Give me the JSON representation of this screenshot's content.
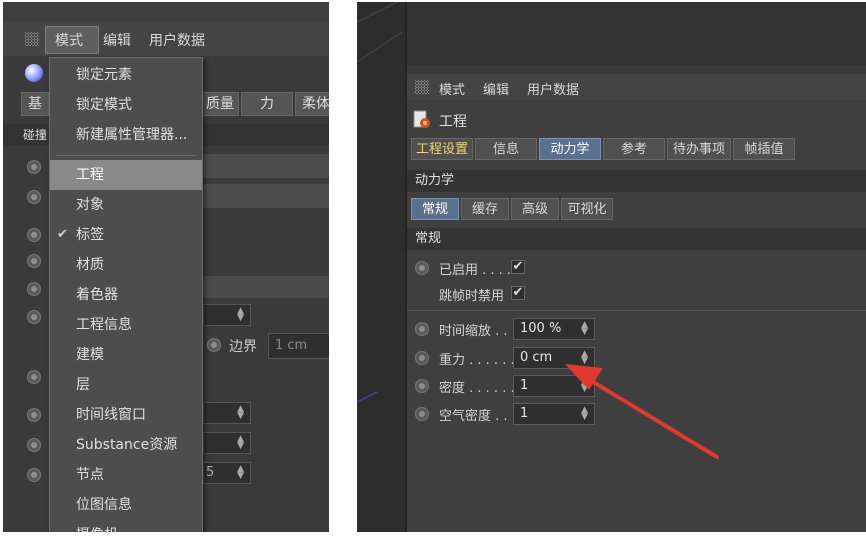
{
  "left": {
    "menubar": {
      "mode": "模式",
      "edit": "编辑",
      "userdata": "用户数据"
    },
    "tabs": [
      "基",
      "质量",
      "力",
      "柔体"
    ],
    "section": "碰撞",
    "border_label": "边界",
    "border_value": "1 cm",
    "partial_value": "5",
    "dropdown": {
      "items_top": [
        "锁定元素",
        "锁定模式",
        "新建属性管理器..."
      ],
      "items": [
        "工程",
        "对象",
        "标签",
        "材质",
        "着色器",
        "工程信息",
        "建模",
        "层",
        "时间线窗口",
        "Substance资源",
        "节点",
        "位图信息",
        "摄像机"
      ],
      "selected": "工程",
      "checked": "标签"
    }
  },
  "right": {
    "menubar": {
      "mode": "模式",
      "edit": "编辑",
      "userdata": "用户数据"
    },
    "title": "工程",
    "tabs": [
      "工程设置",
      "信息",
      "动力学",
      "参考",
      "待办事项",
      "帧插值"
    ],
    "active_tab": "动力学",
    "section_dynamics": "动力学",
    "subtabs": [
      "常规",
      "缓存",
      "高级",
      "可视化"
    ],
    "active_subtab": "常规",
    "section_general": "常规",
    "enabled_label": "已启用 . . . . .",
    "skip_label": "跳帧时禁用",
    "fields": [
      {
        "label": "时间缩放 . .",
        "value": "100 %"
      },
      {
        "label": "重力 . . . . . .",
        "value": "0 cm"
      },
      {
        "label": "密度 . . . . . .",
        "value": "1"
      },
      {
        "label": "空气密度 . .",
        "value": "1"
      }
    ],
    "check_mark": "✔"
  },
  "colors": {
    "arrow": "#e03a2e",
    "active_tab": "#5b6f8e",
    "menu_selected": "#898989"
  }
}
